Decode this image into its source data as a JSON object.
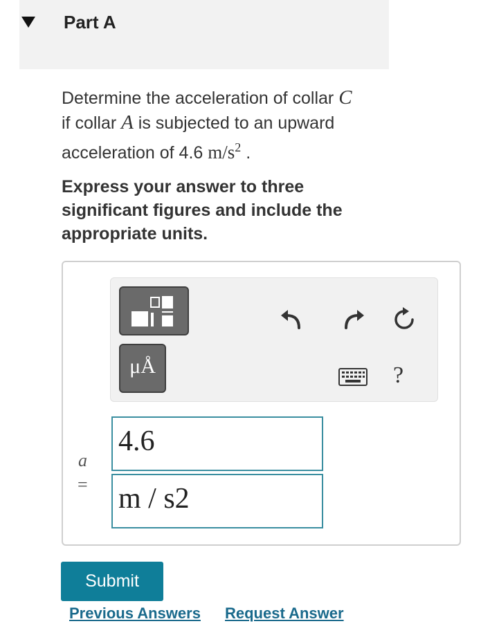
{
  "part": {
    "title": "Part A"
  },
  "question": {
    "line1_prefix": "Determine the acceleration of collar ",
    "collar_c": "C",
    "line2_prefix": "if collar ",
    "collar_a": "A",
    "line2_suffix": " is subjected to an upward",
    "line3_prefix": "acceleration of 4.6 ",
    "unit_main": "m/s",
    "unit_exp": "2",
    "line3_suffix": " ."
  },
  "instruction": {
    "text": "Express your answer to three significant figures and include the appropriate units."
  },
  "toolbar": {
    "templates_icon": "templates-icon",
    "units_label": "μÅ",
    "undo_icon": "undo-icon",
    "redo_icon": "redo-icon",
    "reset_icon": "reset-icon",
    "keyboard_icon": "keyboard-icon",
    "help_label": "?"
  },
  "answer": {
    "variable": "a",
    "equals": "=",
    "value": "4.6",
    "units": "m / s2"
  },
  "actions": {
    "submit_label": "Submit",
    "previous_answers_label": "Previous Answers",
    "request_answer_label": "Request Answer"
  },
  "colors": {
    "submit_bg": "#0f7e99",
    "field_border": "#3a8ea0",
    "link": "#1a6a8c",
    "header_bg": "#f2f2f2"
  }
}
